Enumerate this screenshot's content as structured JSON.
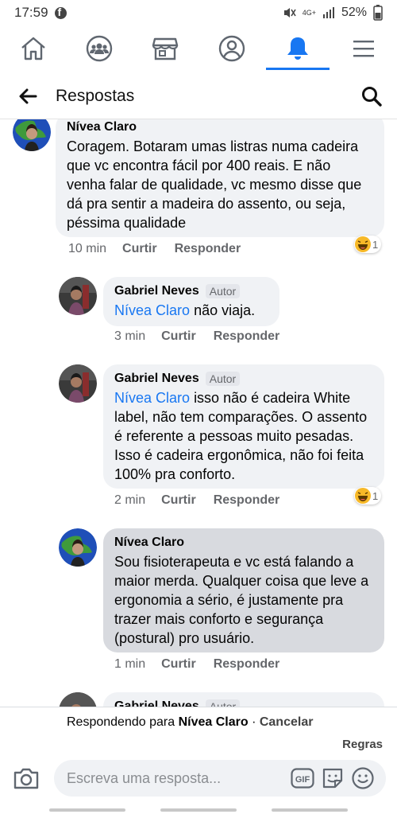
{
  "status_bar": {
    "time": "17:59",
    "network": "4G+",
    "battery": "52%"
  },
  "nav": {
    "tabs": [
      "home",
      "groups",
      "marketplace",
      "profile",
      "notifications",
      "menu"
    ],
    "active": "notifications"
  },
  "header": {
    "title": "Respostas"
  },
  "comments": [
    {
      "author": "Nívea Claro",
      "badge": "",
      "mention": "",
      "text": "Coragem. Botaram umas listras numa cadeira que vc encontra fácil por 400 reais. E não venha falar de qualidade, vc mesmo disse que dá pra sentir a madeira do assento, ou seja, péssima qualidade",
      "time": "10 min",
      "like": "Curtir",
      "reply": "Responder",
      "reaction_count": "1"
    },
    {
      "author": "Gabriel Neves",
      "badge": "Autor",
      "mention": "Nívea Claro",
      "text": "não viaja.",
      "time": "3 min",
      "like": "Curtir",
      "reply": "Responder",
      "reaction_count": ""
    },
    {
      "author": "Gabriel Neves",
      "badge": "Autor",
      "mention": "Nívea Claro",
      "text": "isso não é cadeira White label, não tem comparações. O assento é referente a pessoas muito pesadas. Isso é cadeira ergonômica, não foi feita 100% pra conforto.",
      "time": "2 min",
      "like": "Curtir",
      "reply": "Responder",
      "reaction_count": "1"
    },
    {
      "author": "Nívea Claro",
      "badge": "",
      "mention": "",
      "text": "Sou fisioterapeuta e vc está falando a maior merda. Qualquer coisa que leve a ergonomia a sério, é justamente pra trazer mais conforto e segurança (postural) pro usuário.",
      "time": "1 min",
      "like": "Curtir",
      "reply": "Responder",
      "reaction_count": ""
    },
    {
      "author": "Gabriel Neves",
      "badge": "Autor",
      "mention": "",
      "text": "",
      "time": "",
      "like": "",
      "reply": "",
      "reaction_count": ""
    }
  ],
  "reply_bar": {
    "prefix": "Respondendo para",
    "target": "Nívea Claro",
    "separator": "·",
    "cancel": "Cancelar",
    "rules": "Regras",
    "placeholder": "Escreva uma resposta...",
    "gif_label": "GIF"
  },
  "colors": {
    "accent": "#1877f2",
    "bubble": "#f0f2f5",
    "bubble_highlight": "#d8dadf",
    "meta": "#65676b"
  }
}
